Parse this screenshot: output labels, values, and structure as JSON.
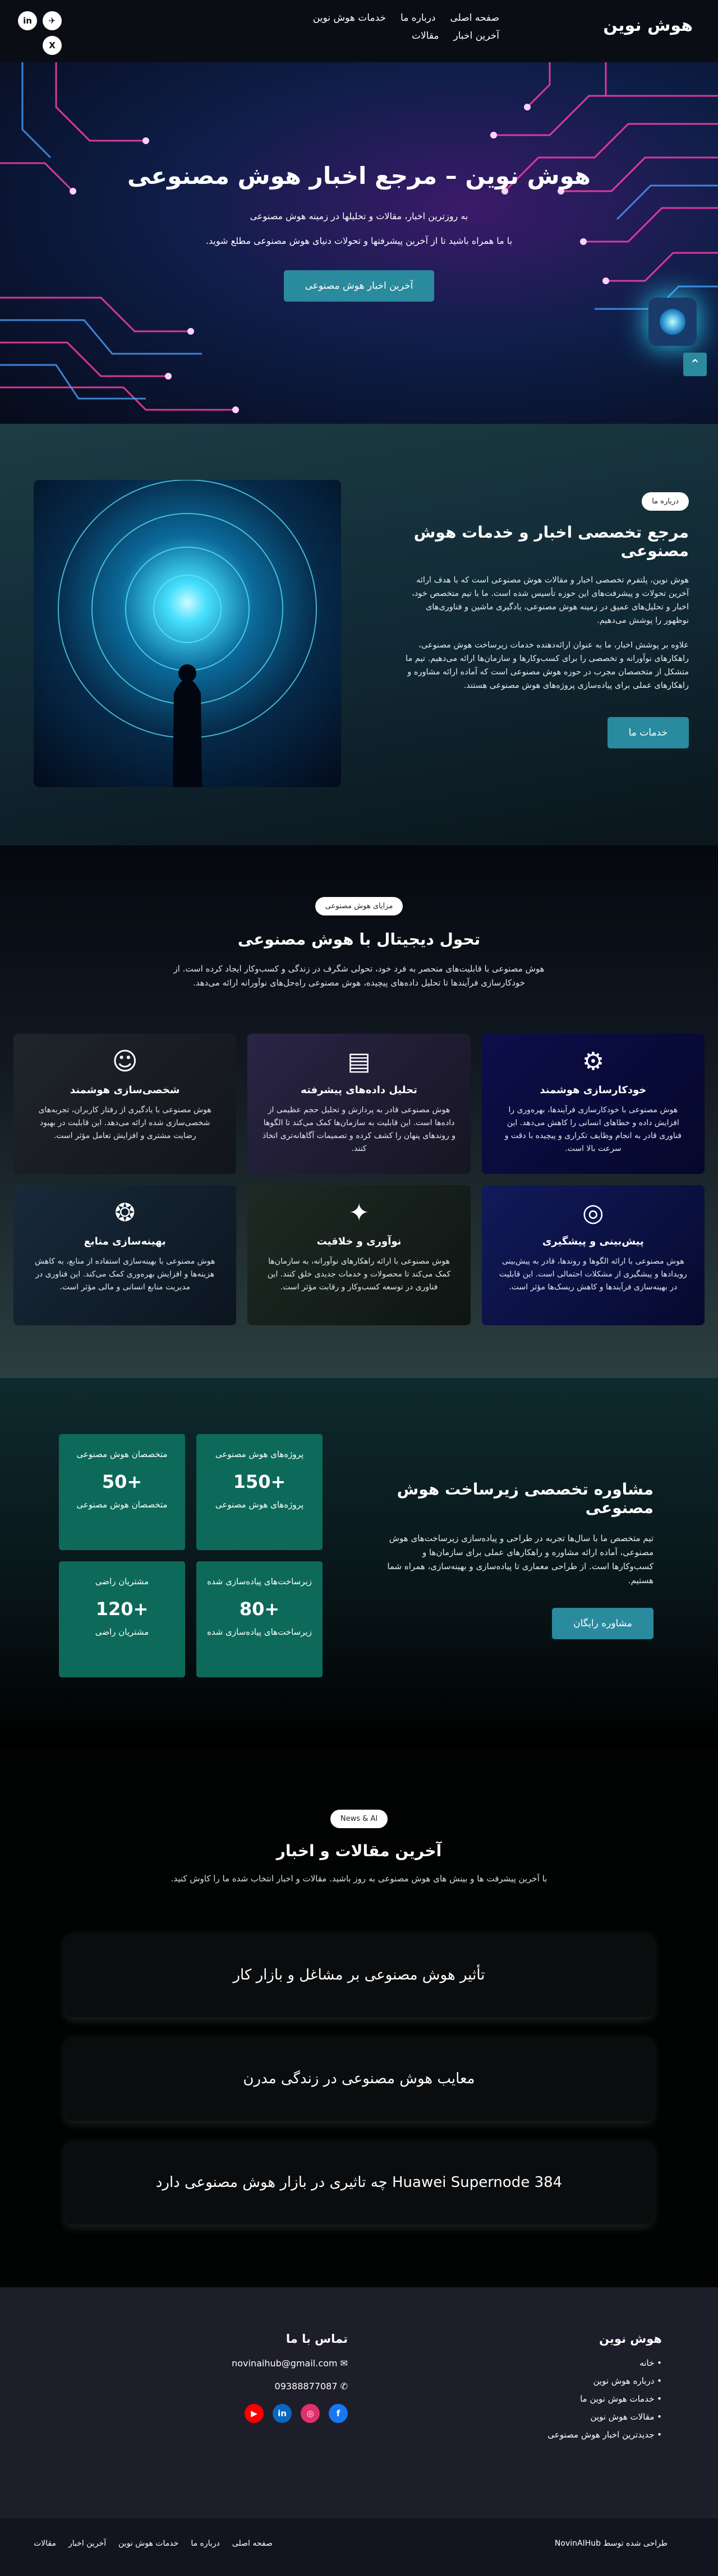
{
  "header": {
    "logo": "هوش نوین",
    "nav": [
      "صفحه اصلی",
      "درباره ما",
      "خدمات هوش نوین",
      "آخرین اخبار",
      "مقالات"
    ],
    "social": [
      "✈",
      "in",
      "X"
    ]
  },
  "hero": {
    "title": "هوش نوین – مرجع اخبار هوش مصنوعی",
    "line1": "به روزترین اخبار، مقالات و تحلیلها در زمینه هوش مصنوعی",
    "line2": "با ما همراه باشید تا از آخرین پیشرفتها و تحولات دنیای هوش مصنوعی مطلع شوید.",
    "button": "آخرین اخبار هوش مصنوعی",
    "totop_icon": "⌃"
  },
  "about": {
    "pill": "درباره ما",
    "title": "مرجع تخصصی اخبار و خدمات هوش مصنوعی",
    "p1": "هوش نوین، پلتفرم تخصصی اخبار و مقالات هوش مصنوعی است که با هدف ارائه آخرین تحولات و پیشرفت‌های این حوزه تأسیس شده است. ما با تیم متخصص خود، اخبار و تحلیل‌های عمیق در زمینه هوش مصنوعی، یادگیری ماشین و فناوری‌های نوظهور را پوشش می‌دهیم.",
    "p2": "علاوه بر پوشش اخبار، ما به عنوان ارائه‌دهنده خدمات زیرساخت هوش مصنوعی، راهکارهای نوآورانه و تخصصی را برای کسب‌وکارها و سازمان‌ها ارائه می‌دهیم. تیم ما متشکل از متخصصان مجرب در حوزه هوش مصنوعی است که آماده ارائه مشاوره و راهکارهای عملی برای پیاده‌سازی پروژه‌های هوش مصنوعی هستند.",
    "button": "خدمات ما"
  },
  "services": {
    "pill": "مزایای هوش مصنوعی",
    "title": "تحول دیجیتال با هوش مصنوعی",
    "lead": "هوش مصنوعی با قابلیت‌های منحصر به فرد خود، تحولی شگرف در زندگی و کسب‌وکار ایجاد کرده است. از خودکارسازی فرآیندها تا تحلیل داده‌های پیچیده، هوش مصنوعی راه‌حل‌های نوآورانه ارائه می‌دهد.",
    "cards": [
      {
        "icon": "⚙",
        "title": "خودکارسازی هوشمند",
        "text": "هوش مصنوعی با خودکارسازی فرآیندها، بهره‌وری را افزایش داده و خطاهای انسانی را کاهش می‌دهد. این فناوری قادر به انجام وظایف تکراری و پیچیده با دقت و سرعت بالا است.",
        "bg": "linear-gradient(135deg,#0c0f4a,#05072a)"
      },
      {
        "icon": "▤",
        "title": "تحلیل داده‌های پیشرفته",
        "text": "هوش مصنوعی قادر به پردازش و تحلیل حجم عظیمی از داده‌ها است. این قابلیت به سازمان‌ها کمک می‌کند تا الگوها و روندهای پنهان را کشف کرده و تصمیمات آگاهانه‌تری اتخاذ کنند.",
        "bg": "linear-gradient(135deg,#2a2546,#161522)"
      },
      {
        "icon": "☺",
        "title": "شخصی‌سازی هوشمند",
        "text": "هوش مصنوعی با یادگیری از رفتار کاربران، تجربه‌های شخصی‌سازی شده ارائه می‌دهد. این قابلیت در بهبود رضایت مشتری و افزایش تعامل مؤثر است.",
        "bg": "linear-gradient(135deg,#20252c,#121519)"
      },
      {
        "icon": "◎",
        "title": "پیش‌بینی و پیشگیری",
        "text": "هوش مصنوعی با ارائه الگوها و روندها، قادر به پیش‌بینی رویدادها و پیشگیری از مشکلات احتمالی است. این قابلیت در بهینه‌سازی فرآیندها و کاهش ریسک‌ها مؤثر است.",
        "bg": "linear-gradient(135deg,#121a5a,#060a2e)"
      },
      {
        "icon": "✦",
        "title": "نوآوری و خلاقیت",
        "text": "هوش مصنوعی با ارائه راهکارهای نوآورانه، به سازمان‌ها کمک می‌کند تا محصولات و خدمات جدیدی خلق کنند. این فناوری در توسعه کسب‌وکار و رقابت مؤثر است.",
        "bg": "linear-gradient(135deg,#1e2a24,#0e1512)"
      },
      {
        "icon": "❂",
        "title": "بهینه‌سازی منابع",
        "text": "هوش مصنوعی با بهینه‌سازی استفاده از منابع، به کاهش هزینه‌ها و افزایش بهره‌وری کمک می‌کند. این فناوری در مدیریت منابع انسانی و مالی مؤثر است.",
        "bg": "linear-gradient(135deg,#182a3a,#0c1520)"
      }
    ]
  },
  "consult": {
    "title": "مشاوره تخصصی زیرساخت هوش مصنوعی",
    "text": "تیم متخصص ما با سال‌ها تجربه در طراحی و پیاده‌سازی زیرساخت‌های هوش مصنوعی، آماده ارائه مشاوره و راهکارهای عملی برای سازمان‌ها و کسب‌وکارها است. از طراحی معماری تا پیاده‌سازی و بهینه‌سازی، همراه شما هستیم.",
    "button": "مشاوره رایگان",
    "stats": [
      {
        "cap": "پروژه‌های هوش مصنوعی",
        "num": "+150",
        "lbl": "پروژه‌های هوش مصنوعی"
      },
      {
        "cap": "متخصصان هوش مصنوعی",
        "num": "+50",
        "lbl": "متخصصان هوش مصنوعی"
      },
      {
        "cap": "زیرساخت‌های پیاده‌سازی شده",
        "num": "+80",
        "lbl": "زیرساخت‌های پیاده‌سازی شده"
      },
      {
        "cap": "مشتریان راضی",
        "num": "+120",
        "lbl": "مشتریان راضی"
      }
    ]
  },
  "articles": {
    "pill": "News & AI",
    "title": "آخرین مقالات و اخبار",
    "lead": "با آخرین پیشرفت ها و بینش های هوش مصنوعی به روز باشید. مقالات و اخبار انتخاب شده ما را کاوش کنید.",
    "items": [
      "تأثیر هوش مصنوعی بر مشاغل و بازار کار",
      "معایب هوش مصنوعی در زندگی مدرن",
      "Huawei Supernode 384 چه تاثیری در بازار هوش مصنوعی دارد"
    ]
  },
  "footer": {
    "col1_title": "هوش نوین",
    "links": [
      "خانه",
      "درباره هوش نوین",
      "خدمات هوش نوین ما",
      "مقالات هوش نوین",
      "جدیدترین اخبار هوش مصنوعی"
    ],
    "col2_title": "تماس با ما",
    "email": "novinaihub@gmail.com",
    "phone": "09388877087",
    "social": [
      {
        "icon": "f",
        "color": "#1877f2"
      },
      {
        "icon": "◎",
        "color": "#e1306c"
      },
      {
        "icon": "in",
        "color": "#0a66c2"
      },
      {
        "icon": "▶",
        "color": "#ff0000"
      }
    ],
    "credit": "طراحی شده توسط NovinAIHub",
    "bottom_nav": [
      "صفحه اصلی",
      "درباره ما",
      "خدمات هوش نوین",
      "آخرین اخبار",
      "مقالات"
    ]
  }
}
